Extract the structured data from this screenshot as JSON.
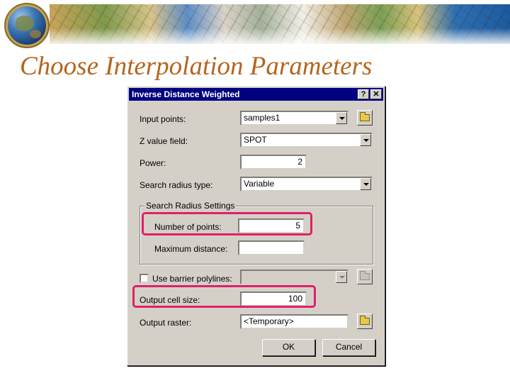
{
  "slide": {
    "title": "Choose Interpolation Parameters"
  },
  "dialog": {
    "title": "Inverse Distance Weighted",
    "help_button": "?",
    "close_button": "✕",
    "input_points": {
      "label": "Input points:",
      "value": "samples1"
    },
    "z_value_field": {
      "label": "Z value field:",
      "value": "SPOT"
    },
    "power": {
      "label": "Power:",
      "value": "2"
    },
    "search_radius_type": {
      "label": "Search radius type:",
      "value": "Variable"
    },
    "search_radius_settings": {
      "title": "Search Radius Settings",
      "number_of_points": {
        "label": "Number of points:",
        "value": "5"
      },
      "maximum_distance": {
        "label": "Maximum distance:",
        "value": ""
      }
    },
    "use_barrier": {
      "label": "Use barrier polylines:",
      "checked": false,
      "value": ""
    },
    "output_cell_size": {
      "label": "Output cell size:",
      "value": "100"
    },
    "output_raster": {
      "label": "Output raster:",
      "value": "<Temporary>"
    },
    "ok_label": "OK",
    "cancel_label": "Cancel"
  },
  "colors": {
    "highlight": "#e0206a",
    "title_text": "#b5651d",
    "titlebar": "#000080",
    "dialog_face": "#d4d0c8"
  }
}
